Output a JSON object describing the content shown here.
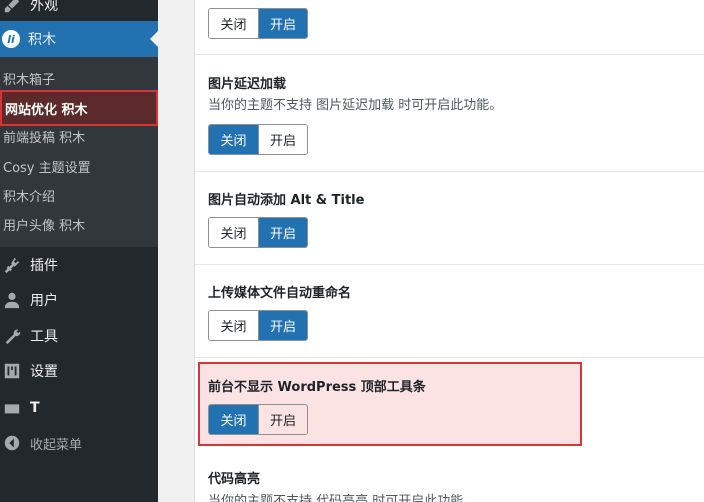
{
  "sidebar": {
    "top_item": "外观",
    "active_item": "积木",
    "active_icon_text": "li",
    "submenu": [
      "积木箱子",
      "网站优化 积木",
      "前端投稿 积木",
      "Cosy 主题设置",
      "积木介绍",
      "用户头像 积木"
    ],
    "items": [
      {
        "label": "插件",
        "icon": "plug-icon"
      },
      {
        "label": "用户",
        "icon": "user-icon"
      },
      {
        "label": "工具",
        "icon": "wrench-icon"
      },
      {
        "label": "设置",
        "icon": "settings-icon"
      },
      {
        "label": "T",
        "icon": "plugin-icon"
      }
    ],
    "collapse": "收起菜单"
  },
  "settings": {
    "top_toggle": {
      "off": "关闭",
      "on": "开启",
      "selected": "on"
    },
    "rows": [
      {
        "title": "图片延迟加载",
        "desc": "当你的主题不支持 图片延迟加载 时可开启此功能。",
        "off": "关闭",
        "on": "开启",
        "selected": "off"
      },
      {
        "title": "图片自动添加 Alt & Title",
        "desc": "",
        "off": "关闭",
        "on": "开启",
        "selected": "on"
      },
      {
        "title": "上传媒体文件自动重命名",
        "desc": "",
        "off": "关闭",
        "on": "开启",
        "selected": "on"
      },
      {
        "title": "前台不显示 WordPress 顶部工具条",
        "desc": "",
        "off": "关闭",
        "on": "开启",
        "selected": "off"
      },
      {
        "title": "代码高亮",
        "desc": "当你的主题不支持 代码高亮 时可开启此功能。"
      }
    ]
  },
  "colors": {
    "accent": "#2271b1",
    "highlight_border": "#d63638",
    "highlight_bg": "#fbe3e4"
  }
}
